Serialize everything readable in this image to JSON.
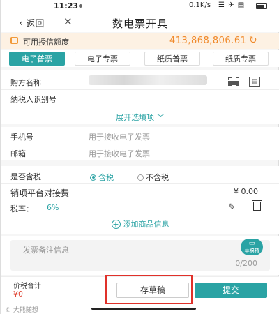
{
  "status_bar": {
    "time": "11:23",
    "network": "0.1K/s",
    "signal": "☰ ✈ ▤"
  },
  "nav": {
    "back_label": "返回",
    "title": "数电票开具"
  },
  "credit": {
    "label": "可用授信额度",
    "amount": "413,868,806.61"
  },
  "tabs": [
    {
      "label": "电子普票",
      "active": true
    },
    {
      "label": "电子专票",
      "active": false
    },
    {
      "label": "纸质普票",
      "active": false
    },
    {
      "label": "纸质专票",
      "active": false
    }
  ],
  "buyer": {
    "name_label": "购方名称",
    "tax_id_label": "纳税人识别号",
    "expand_label": "展开选填项"
  },
  "contact": {
    "phone_label": "手机号",
    "phone_placeholder": "用于接收电子发票",
    "email_label": "邮箱",
    "email_placeholder": "用于接收电子发票"
  },
  "tax": {
    "label": "是否含税",
    "option_yes": "含税",
    "option_no": "不含税"
  },
  "item": {
    "name": "销项平台对接费",
    "price": "¥ 0.00",
    "rate_label": "税率：",
    "rate_value": "6%",
    "add_label": "添加商品信息"
  },
  "remark": {
    "placeholder": "发票备注信息",
    "count": "0/200",
    "draft_box_label": "草稿箱"
  },
  "footer": {
    "total_label": "价税合计",
    "total_value": "¥0",
    "save_draft_label": "存草稿",
    "submit_label": "提交"
  },
  "watermark": "© 大熊随想",
  "colors": {
    "accent": "#2aa3a4",
    "orange": "#f0892a",
    "highlight": "#e0312a"
  }
}
